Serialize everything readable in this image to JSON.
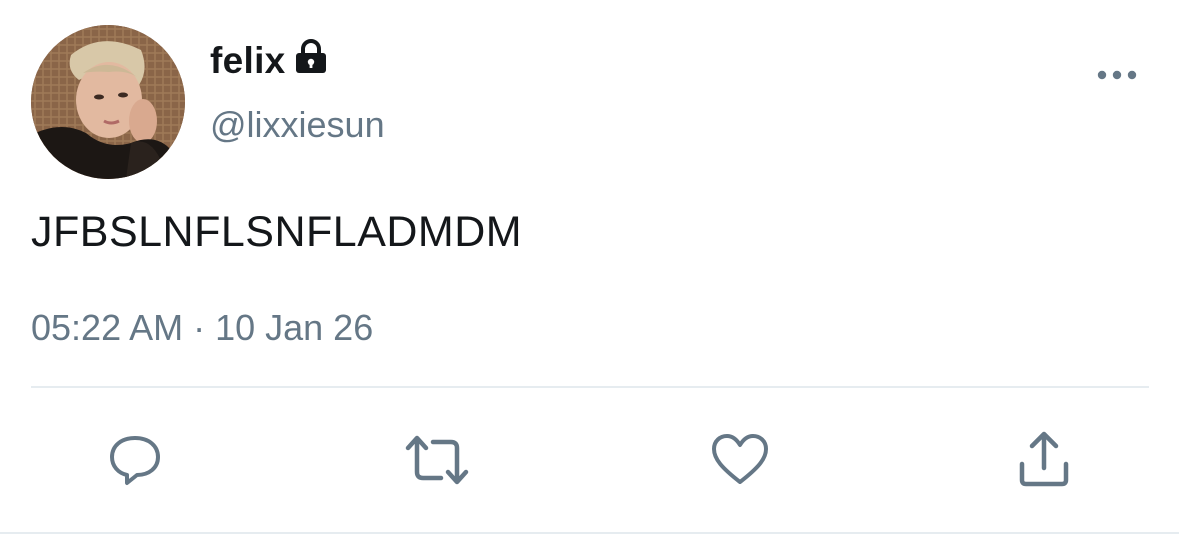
{
  "author": {
    "display_name": "felix",
    "handle": "@lixxiesun",
    "protected_icon": "lock-icon",
    "avatar_icon": "profile-photo"
  },
  "tweet": {
    "text": "JFBSLNFLSNFLADMDM",
    "timestamp": "05:22 AM · 10 Jan 26"
  },
  "menu": {
    "icon": "more-options-icon"
  },
  "actions": [
    {
      "name": "reply",
      "icon": "reply-icon"
    },
    {
      "name": "retweet",
      "icon": "retweet-icon"
    },
    {
      "name": "like",
      "icon": "heart-icon"
    },
    {
      "name": "share",
      "icon": "share-icon"
    }
  ],
  "colors": {
    "text_primary": "#14171a",
    "text_secondary": "#657786",
    "icon_gray": "#657786",
    "divider": "#e6ecf0"
  }
}
